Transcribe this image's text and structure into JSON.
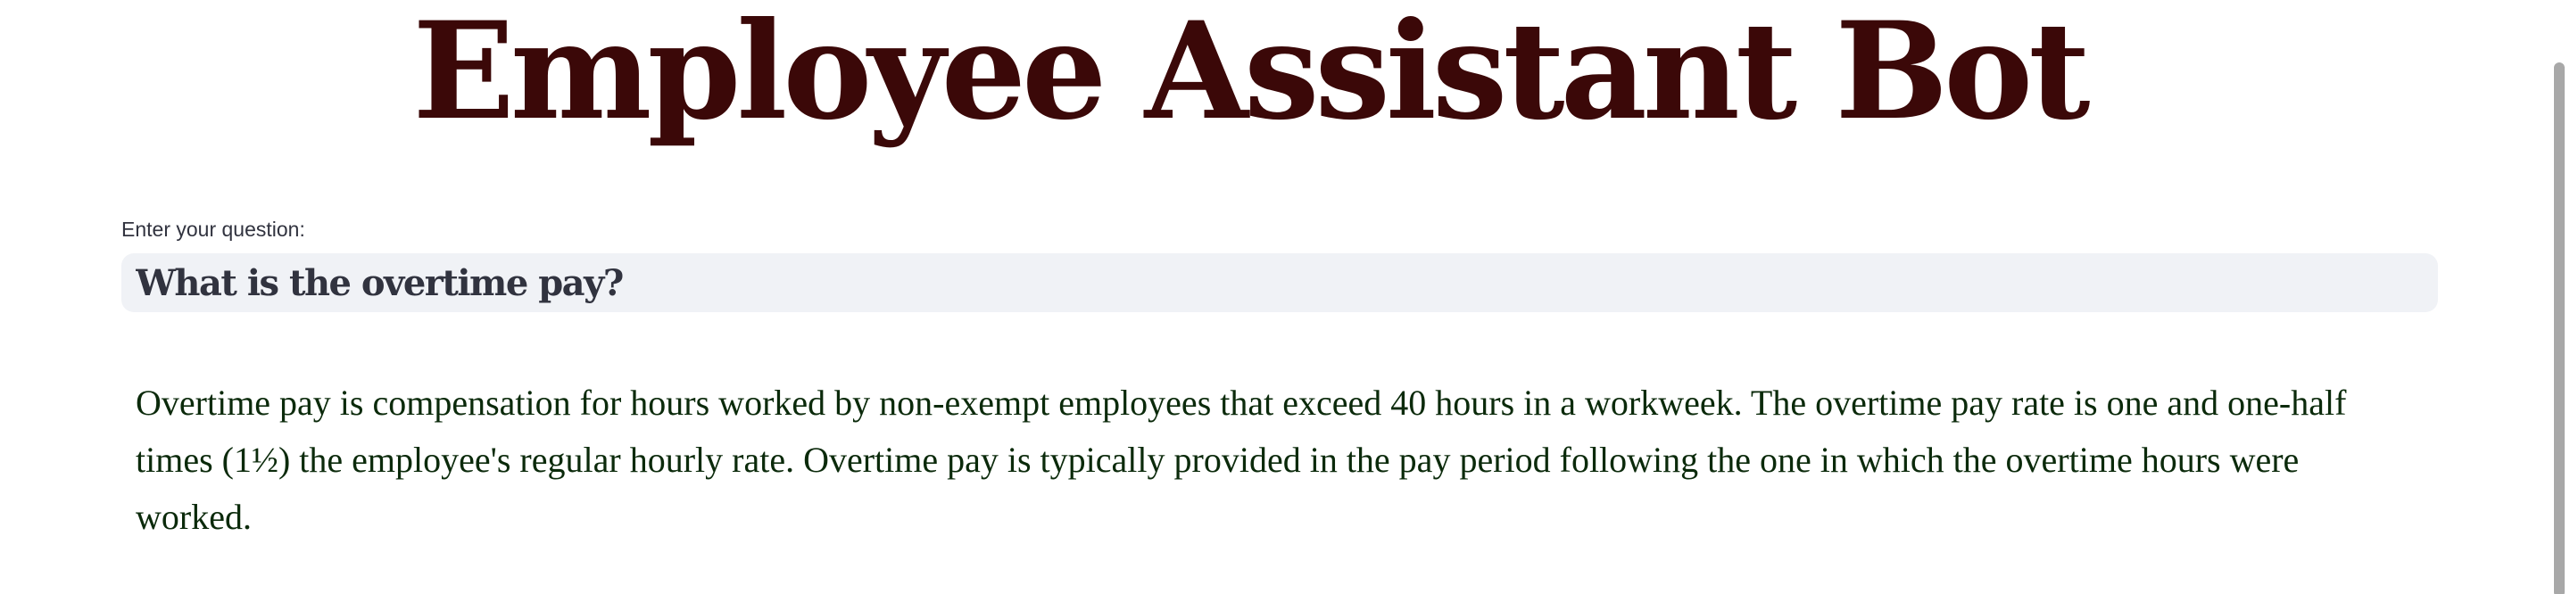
{
  "header": {
    "title": "Employee Assistant Bot"
  },
  "question": {
    "label": "Enter your question:",
    "value": "What is the overtime pay?"
  },
  "answer": {
    "text": "Overtime pay is compensation for hours worked by non-exempt employees that exceed 40 hours in a workweek. The overtime pay rate is one and one-half times (1½) the employee's regular hourly rate. Overtime pay is typically provided in the pay period following the one in which the overtime hours were worked."
  },
  "colors": {
    "title": "#3b0808",
    "input_background": "#f0f2f6",
    "answer_text": "#0b2a0b"
  }
}
